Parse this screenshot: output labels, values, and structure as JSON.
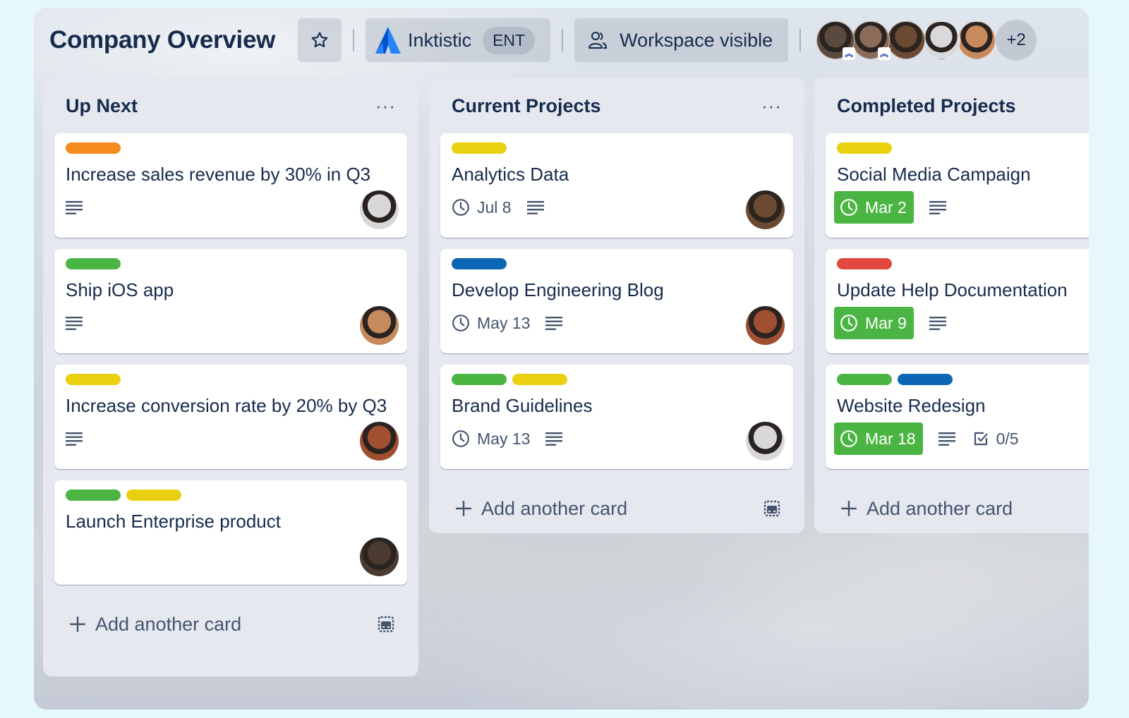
{
  "header": {
    "board_title": "Company Overview",
    "star_icon": "star-icon",
    "workspace": {
      "icon": "atlassian-logo-icon",
      "name": "Inktistic",
      "plan_badge": "ENT"
    },
    "visibility": {
      "icon": "people-icon",
      "label": "Workspace visible"
    },
    "members": [
      {
        "name": "member-1",
        "color": "#5a4a3e",
        "admin": true
      },
      {
        "name": "member-2",
        "color": "#8a6c58",
        "admin": true
      },
      {
        "name": "member-3",
        "color": "#6a4a32",
        "admin": false
      },
      {
        "name": "member-4",
        "color": "#d9d9dc",
        "admin": false
      },
      {
        "name": "member-5",
        "color": "#c68a5c",
        "admin": false
      }
    ],
    "admin_badge_icon": "double-chevron-up-icon",
    "more_members": "+2"
  },
  "lists": [
    {
      "title": "Up Next",
      "menu": "···",
      "cards": [
        {
          "labels": [
            "#f58a1f"
          ],
          "title": "Increase sales revenue by 30% in Q3",
          "due": null,
          "has_description": true,
          "avatar_color": "#d8d8db"
        },
        {
          "labels": [
            "#4bb543"
          ],
          "title": "Ship iOS app",
          "due": null,
          "has_description": true,
          "avatar_color": "#c68a5c"
        },
        {
          "labels": [
            "#e9d10f"
          ],
          "title": "Increase conversion rate by 20% by Q3",
          "due": null,
          "has_description": true,
          "avatar_color": "#a05030"
        },
        {
          "labels": [
            "#4bb543",
            "#e9d10f"
          ],
          "title": "Launch Enterprise product",
          "due": null,
          "has_description": false,
          "avatar_color": "#4a3a30"
        }
      ],
      "add_card": "Add another card"
    },
    {
      "title": "Current Projects",
      "menu": "···",
      "cards": [
        {
          "labels": [
            "#e9d10f"
          ],
          "title": "Analytics Data",
          "due": "Jul 8",
          "has_description": true,
          "avatar_color": "#6a4a32"
        },
        {
          "labels": [
            "#0c66b4"
          ],
          "title": "Develop Engineering Blog",
          "due": "May 13",
          "has_description": true,
          "avatar_color": "#a05030"
        },
        {
          "labels": [
            "#4bb543",
            "#e9d10f"
          ],
          "title": "Brand Guidelines",
          "due": "May 13",
          "has_description": true,
          "avatar_color": "#d8d8db"
        }
      ],
      "add_card": "Add another card"
    },
    {
      "title": "Completed Projects",
      "cards": [
        {
          "labels": [
            "#e9d10f"
          ],
          "title": "Social Media Campaign",
          "due": "Mar 2",
          "due_complete": true,
          "has_description": true
        },
        {
          "labels": [
            "#e2483d"
          ],
          "title": "Update Help Documentation",
          "due": "Mar 9",
          "due_complete": true,
          "has_description": true
        },
        {
          "labels": [
            "#4bb543",
            "#0c66b4"
          ],
          "title": "Website Redesign",
          "due": "Mar 18",
          "due_complete": true,
          "has_description": true,
          "checklist": "0/5"
        }
      ],
      "add_card": "Add another card"
    }
  ],
  "colors": {
    "due_complete": "#4bb543",
    "text_primary": "#172b4d",
    "text_subtle": "#44546f"
  }
}
